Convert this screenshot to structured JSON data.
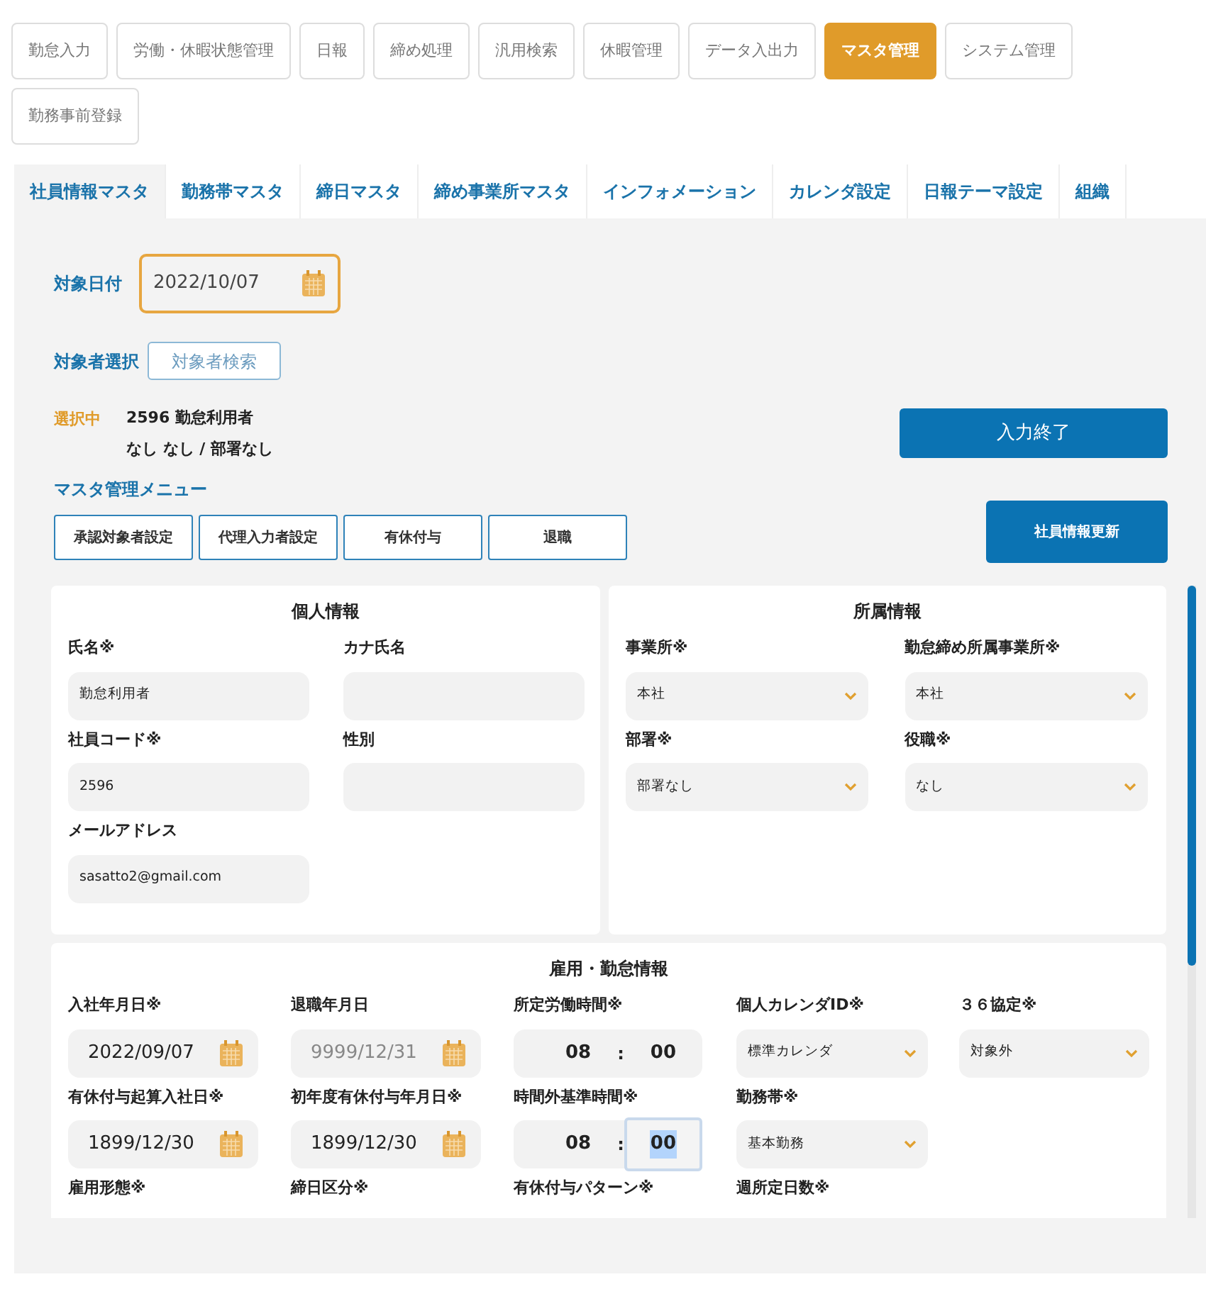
{
  "main_menu": [
    {
      "label": "勤怠入力",
      "selected": false
    },
    {
      "label": "労働・休暇状態管理",
      "selected": false
    },
    {
      "label": "日報",
      "selected": false
    },
    {
      "label": "締め処理",
      "selected": false
    },
    {
      "label": "汎用検索",
      "selected": false
    },
    {
      "label": "休暇管理",
      "selected": false
    },
    {
      "label": "データ入出力",
      "selected": false
    },
    {
      "label": "マスタ管理",
      "selected": true
    },
    {
      "label": "システム管理",
      "selected": false
    },
    {
      "label": "勤務事前登録",
      "selected": false
    }
  ],
  "tabs": [
    {
      "label": "社員情報マスタ",
      "selected": true
    },
    {
      "label": "勤務帯マスタ",
      "selected": false
    },
    {
      "label": "締日マスタ",
      "selected": false
    },
    {
      "label": "締め事業所マスタ",
      "selected": false
    },
    {
      "label": "インフォメーション",
      "selected": false
    },
    {
      "label": "カレンダ設定",
      "selected": false
    },
    {
      "label": "日報テーマ設定",
      "selected": false
    },
    {
      "label": "組織",
      "selected": false
    }
  ],
  "target_date": {
    "label": "対象日付",
    "value": "2022/10/07"
  },
  "target_person": {
    "label": "対象者選択",
    "button": "対象者検索"
  },
  "selection": {
    "label": "選択中",
    "line_1": "2596 勤怠利用者",
    "line_2": "なし なし / 部署なし"
  },
  "finish_button": "入力終了",
  "master_menu": {
    "title": "マスタ管理メニュー",
    "buttons": [
      "承認対象者設定",
      "代理入力者設定",
      "有休付与",
      "退職"
    ]
  },
  "update_button": "社員情報更新",
  "personal_info": {
    "title": "個人情報",
    "fields": [
      {
        "label": "氏名※",
        "kind": "text",
        "value": "勤怠利用者"
      },
      {
        "label": "カナ氏名",
        "kind": "text"
      },
      {
        "label": "社員コード※",
        "kind": "text",
        "value": "2596"
      },
      {
        "label": "性別",
        "kind": "text"
      },
      {
        "label": "メールアドレス",
        "kind": "text",
        "value": "sasatto2@gmail.com"
      }
    ]
  },
  "affiliation": {
    "title": "所属情報",
    "fields": [
      {
        "label": "事業所※",
        "kind": "select",
        "value": "本社"
      },
      {
        "label": "勤怠締め所属事業所※",
        "kind": "select",
        "value": "本社"
      },
      {
        "label": "部署※",
        "kind": "select",
        "value": "部署なし"
      },
      {
        "label": "役職※",
        "kind": "select",
        "value": "なし"
      }
    ]
  },
  "employment": {
    "title": "雇用・勤怠情報",
    "fields": [
      {
        "label": "入社年月日※",
        "kind": "date",
        "value": "2022/09/07",
        "disabled": false
      },
      {
        "label": "退職年月日",
        "kind": "date",
        "value": "9999/12/31",
        "disabled": true
      },
      {
        "label": "所定労働時間※",
        "kind": "time",
        "hours": "08",
        "separator": ":",
        "minutes": "00",
        "focused": false
      },
      {
        "label": "個人カレンダID※",
        "kind": "select",
        "value": "標準カレンダ"
      },
      {
        "label": "３６協定※",
        "kind": "select",
        "value": "対象外"
      },
      {
        "label": "有休付与起算入社日※",
        "kind": "date",
        "value": "1899/12/30",
        "disabled": false
      },
      {
        "label": "初年度有休付与年月日※",
        "kind": "date",
        "value": "1899/12/30",
        "disabled": false
      },
      {
        "label": "時間外基準時間※",
        "kind": "time",
        "hours": "08",
        "separator": ":",
        "minutes": "00",
        "focused": true
      },
      {
        "label": "勤務帯※",
        "kind": "select",
        "value": "基本勤務"
      },
      {
        "kind": "empty"
      },
      {
        "label": "雇用形態※",
        "kind": "label"
      },
      {
        "label": "締日区分※",
        "kind": "label"
      },
      {
        "label": "有休付与パターン※",
        "kind": "label"
      },
      {
        "label": "週所定日数※",
        "kind": "label"
      }
    ]
  }
}
